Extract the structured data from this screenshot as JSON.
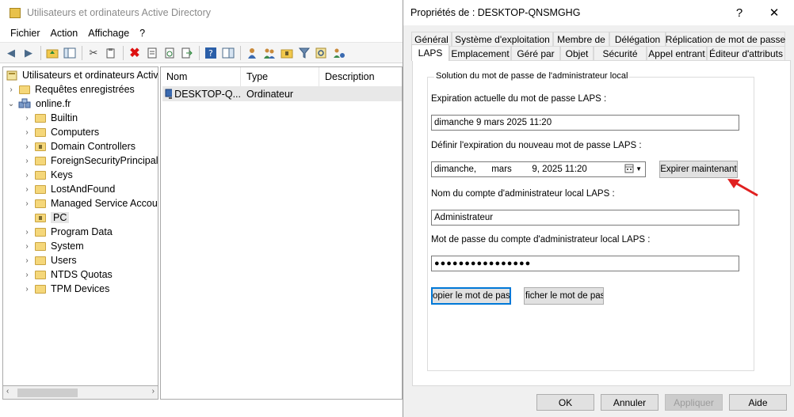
{
  "main_window": {
    "title": "Utilisateurs et ordinateurs Active Directory",
    "menu": [
      "Fichier",
      "Action",
      "Affichage",
      "?"
    ]
  },
  "tree": {
    "root": "Utilisateurs et ordinateurs Active",
    "items": [
      {
        "label": "Requêtes enregistrées"
      },
      {
        "label": "online.fr"
      },
      {
        "label": "Builtin"
      },
      {
        "label": "Computers"
      },
      {
        "label": "Domain Controllers"
      },
      {
        "label": "ForeignSecurityPrincipals"
      },
      {
        "label": "Keys"
      },
      {
        "label": "LostAndFound"
      },
      {
        "label": "Managed Service Accour"
      },
      {
        "label": "PC"
      },
      {
        "label": "Program Data"
      },
      {
        "label": "System"
      },
      {
        "label": "Users"
      },
      {
        "label": "NTDS Quotas"
      },
      {
        "label": "TPM Devices"
      }
    ]
  },
  "list": {
    "columns": [
      "Nom",
      "Type",
      "Description"
    ],
    "rows": [
      {
        "name": "DESKTOP-Q...",
        "type": "Ordinateur",
        "description": ""
      }
    ]
  },
  "dialog": {
    "title": "Propriétés de : DESKTOP-QNSMGHG",
    "help_symbol": "?",
    "close_symbol": "✕",
    "tabs_row1": [
      "Général",
      "Système d'exploitation",
      "Membre de",
      "Délégation",
      "Réplication de mot de passe"
    ],
    "tabs_row2": [
      "LAPS",
      "Emplacement",
      "Géré par",
      "Objet",
      "Sécurité",
      "Appel entrant",
      "Éditeur d'attributs"
    ],
    "active_tab": "LAPS",
    "group_title": "Solution du mot de passe de l'administrateur local",
    "current_expiration_label": "Expiration actuelle du mot de passe LAPS :",
    "current_expiration_value": "dimanche 9 mars 2025 11:20",
    "new_expiration_label": "Définir l'expiration du nouveau mot de passe LAPS :",
    "new_expiration_value": "dimanche,      mars        9, 2025 11:20",
    "expire_now_button": "Expirer maintenant",
    "account_label": "Nom du compte d'administrateur local LAPS :",
    "account_value": "Administrateur",
    "password_label": "Mot de passe du compte d'administrateur local LAPS :",
    "password_value": "●●●●●●●●●●●●●●●●",
    "copy_button": "opier le mot de passe",
    "show_button": "ficher le mot de passe",
    "ok_button": "OK",
    "cancel_button": "Annuler",
    "apply_button": "Appliquer",
    "help_button": "Aide"
  },
  "colors": {
    "annotation_arrow": "#e02020",
    "focus_border": "#0078d7"
  }
}
